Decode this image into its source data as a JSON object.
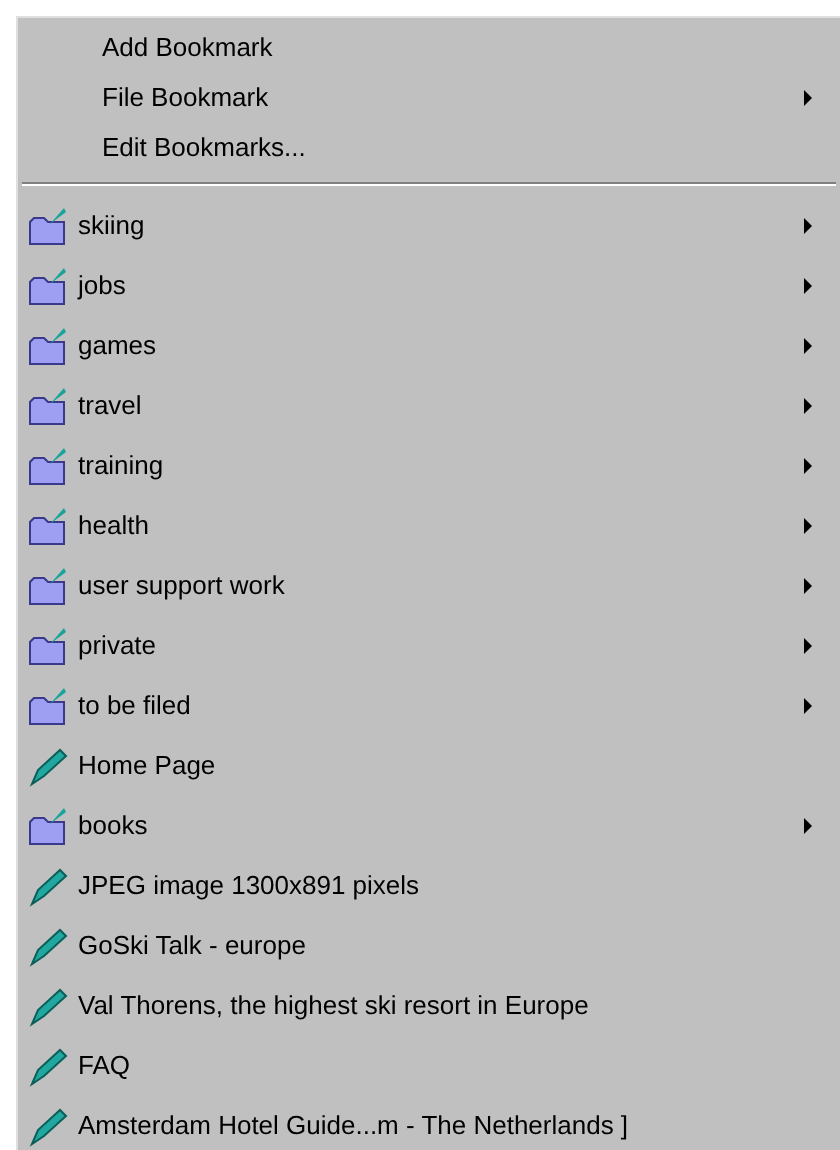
{
  "menu": {
    "commands": [
      {
        "label": "Add Bookmark",
        "submenu": false
      },
      {
        "label": "File Bookmark",
        "submenu": true
      },
      {
        "label": "Edit Bookmarks...",
        "submenu": false
      }
    ],
    "items": [
      {
        "kind": "folder",
        "label": "skiing",
        "submenu": true
      },
      {
        "kind": "folder",
        "label": "jobs",
        "submenu": true
      },
      {
        "kind": "folder",
        "label": "games",
        "submenu": true
      },
      {
        "kind": "folder",
        "label": "travel",
        "submenu": true
      },
      {
        "kind": "folder",
        "label": "training",
        "submenu": true
      },
      {
        "kind": "folder",
        "label": "health",
        "submenu": true
      },
      {
        "kind": "folder",
        "label": "user support work",
        "submenu": true
      },
      {
        "kind": "folder",
        "label": "private",
        "submenu": true
      },
      {
        "kind": "folder",
        "label": "to be filed",
        "submenu": true
      },
      {
        "kind": "bookmark",
        "label": "Home Page",
        "submenu": false
      },
      {
        "kind": "folder",
        "label": "books",
        "submenu": true
      },
      {
        "kind": "bookmark",
        "label": "JPEG image 1300x891 pixels",
        "submenu": false
      },
      {
        "kind": "bookmark",
        "label": "GoSki Talk - europe",
        "submenu": false
      },
      {
        "kind": "bookmark",
        "label": "Val Thorens, the highest ski resort in Europe",
        "submenu": false
      },
      {
        "kind": "bookmark",
        "label": "FAQ",
        "submenu": false
      },
      {
        "kind": "bookmark",
        "label": "Amsterdam Hotel Guide...m - The Netherlands ]",
        "submenu": false
      }
    ]
  }
}
